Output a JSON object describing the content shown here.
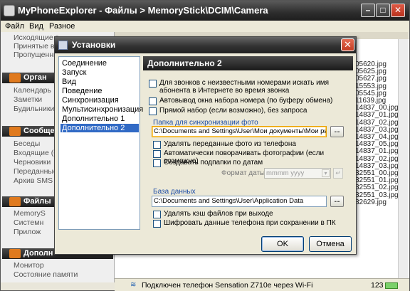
{
  "window": {
    "title": "MyPhoneExplorer  -  Файлы > MemoryStick\\DCIM\\Camera",
    "min_symbol": "–",
    "max_symbol": "□",
    "close_symbol": "✕"
  },
  "menu": [
    "Файл",
    "Вид",
    "Разное"
  ],
  "leftnav": {
    "groups": [
      {
        "label": "Органайзер",
        "header_text": "Орган",
        "items": [
          "Календарь",
          "Заметки",
          "Будильники"
        ]
      },
      {
        "label": "Сообщения",
        "header_text": "Сообще",
        "items": [
          "Беседы",
          "Входящие (6",
          "Черновики",
          "Переданные",
          "Архив SMS (6"
        ]
      },
      {
        "label": "Файлы",
        "header_text": "Файлы",
        "items": [
          "MemoryS",
          "Системн",
          "Прилож"
        ]
      },
      {
        "label": "Дополнительно",
        "header_text": "Дополн",
        "items": [
          "Монитор",
          "Состояние памяти"
        ]
      }
    ],
    "top_items": [
      "Исходящие в",
      "Принятые в",
      "Пропущенны"
    ]
  },
  "filelist": {
    "rows": [
      "05620.jpg",
      "05625.jpg",
      "05627.jpg",
      "15553.jpg",
      "05545.jpg",
      "11639.jpg",
      "14837_00.jpg",
      "14837_01.jpg",
      "14837_02.jpg",
      "14837_03.jpg",
      "14837_04.jpg",
      "14837_05.jpg",
      "14837_01.jpg",
      "14837_02.jpg",
      "14837_03.jpg",
      "32551_00.jpg",
      "32551_01.jpg",
      "32551_02.jpg",
      "32551_03.jpg",
      "32629.jpg"
    ]
  },
  "statusbar": {
    "text": "Подключен телефон Sensation Z710e через Wi-Fi",
    "number": "123",
    "wifi_icon": "wifi-icon"
  },
  "dialog": {
    "title": "Установки",
    "close_symbol": "✕",
    "nav": [
      "Соединение",
      "Запуск",
      "Вид",
      "Поведение",
      "Синхронизация",
      "Мультисинхронизация",
      "Дополнительно 1",
      "Дополнительно 2"
    ],
    "selected_index": 7,
    "panel_title": "Дополнительно 2",
    "checkboxes_top": [
      "Для звонков с неизвестными номерами искать имя абонента в Интернете во время звонка",
      "Автовывод окна набора номера (по буферу обмена)",
      "Прямой набор (если возможно), без запроса"
    ],
    "photo_sync": {
      "group_label": "Папка для синхронизации фото",
      "path": "C:\\Documents and Settings\\User\\Мои документы\\Мои рисунки",
      "browse": "...",
      "checkboxes": [
        "Удалять переданные фото из телефона",
        "Автоматически поворачивать фотографии (если возможно)",
        "Создавать подпапки по датам"
      ],
      "date_format_label": "Формат даты:",
      "date_format_value": "mmmm yyyy",
      "date_arrow": "▾",
      "date_btn": "↵"
    },
    "database": {
      "group_label": "База данных",
      "path": "C:\\Documents and Settings\\User\\Application Data",
      "browse": "...",
      "checkboxes": [
        "Удалять кэш файлов при выходе",
        "Шифровать данные телефона при сохранении в ПК"
      ]
    },
    "buttons": {
      "ok": "OK",
      "cancel": "Отмена"
    }
  }
}
